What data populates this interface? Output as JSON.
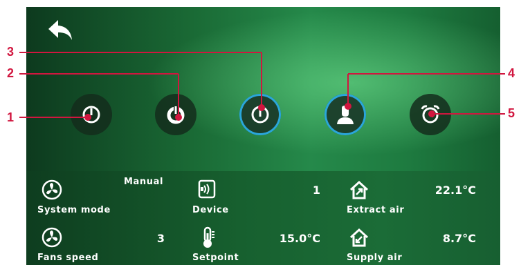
{
  "callouts": [
    "1",
    "2",
    "3",
    "4",
    "5"
  ],
  "modes": [
    {
      "icon": "manual-mode-icon"
    },
    {
      "icon": "power-icon"
    },
    {
      "icon": "auto-mode-icon"
    },
    {
      "icon": "user-profile-icon"
    },
    {
      "icon": "alarm-clock-icon"
    }
  ],
  "status": {
    "system_mode": {
      "label": "System mode",
      "value": "Manual"
    },
    "device": {
      "label": "Device",
      "value": "1"
    },
    "extract_air": {
      "label": "Extract air",
      "value": "22.1°C"
    },
    "fans_speed": {
      "label": "Fans speed",
      "value": "3"
    },
    "setpoint": {
      "label": "Setpoint",
      "value": "15.0°C"
    },
    "supply_air": {
      "label": "Supply air",
      "value": "8.7°C"
    }
  },
  "colors": {
    "callout": "#d1163f",
    "active_ring": "#2aa6d9",
    "screen_green": "#1e7b40"
  }
}
